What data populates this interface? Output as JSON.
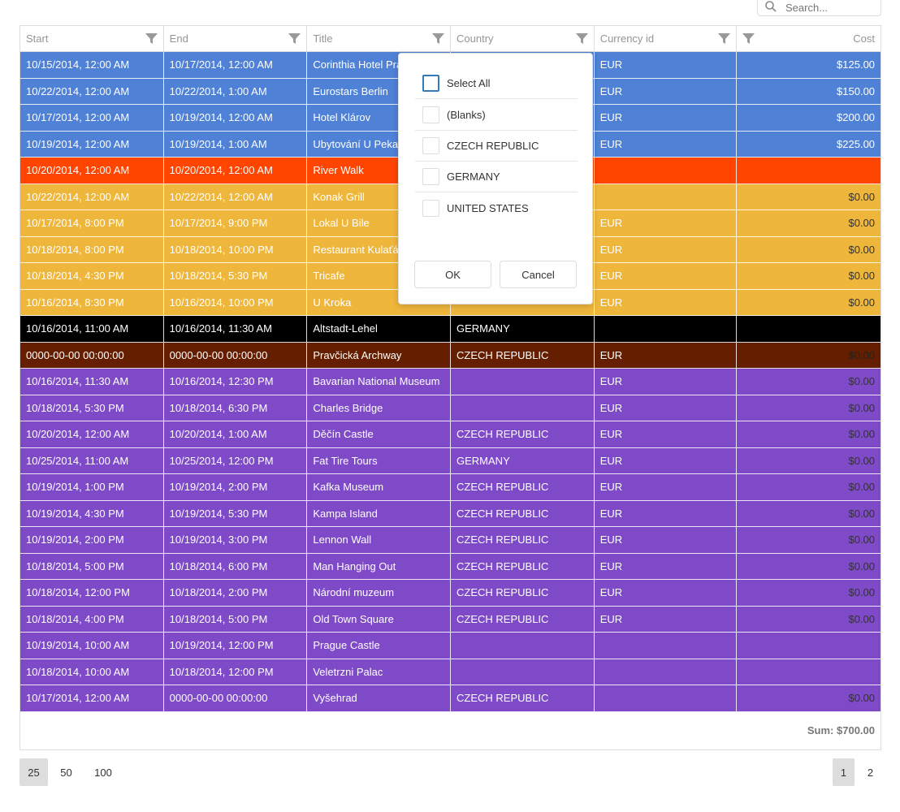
{
  "search": {
    "placeholder": "Search..."
  },
  "columns": [
    {
      "label": "Start"
    },
    {
      "label": "End"
    },
    {
      "label": "Title"
    },
    {
      "label": "Country"
    },
    {
      "label": "Currency id"
    },
    {
      "label": "Cost"
    }
  ],
  "colors": {
    "blue": "#4f81d6",
    "orange_red": "#ff4500",
    "gold": "#efb63c",
    "black": "#000000",
    "brown": "#661e00",
    "purple": "#7e4ac8"
  },
  "rows": [
    {
      "color": "#4f81d6",
      "text": "#ffffff",
      "cells": [
        "10/15/2014, 12:00 AM",
        "10/17/2014, 12:00 AM",
        "Corinthia Hotel Prague",
        "",
        "EUR",
        "$125.00"
      ]
    },
    {
      "color": "#4f81d6",
      "text": "#ffffff",
      "cells": [
        "10/22/2014, 12:00 AM",
        "10/22/2014, 1:00 AM",
        "Eurostars Berlin",
        "",
        "EUR",
        "$150.00"
      ]
    },
    {
      "color": "#4f81d6",
      "text": "#ffffff",
      "cells": [
        "10/17/2014, 12:00 AM",
        "10/19/2014, 12:00 AM",
        "Hotel Klárov",
        "",
        "EUR",
        "$200.00"
      ]
    },
    {
      "color": "#4f81d6",
      "text": "#ffffff",
      "cells": [
        "10/19/2014, 12:00 AM",
        "10/19/2014, 1:00 AM",
        "Ubytování U Pekařů",
        "",
        "EUR",
        "$225.00"
      ]
    },
    {
      "color": "#ff4500",
      "text": "#ffffff",
      "cells": [
        "10/20/2014, 12:00 AM",
        "10/20/2014, 12:00 AM",
        "River Walk",
        "",
        "",
        ""
      ]
    },
    {
      "color": "#efb63c",
      "text": "#ffffff",
      "costText": "#333333",
      "cells": [
        "10/22/2014, 12:00 AM",
        "10/22/2014, 12:00 AM",
        "Konak Grill",
        "",
        "",
        "$0.00"
      ]
    },
    {
      "color": "#efb63c",
      "text": "#ffffff",
      "costText": "#333333",
      "cells": [
        "10/17/2014, 8:00 PM",
        "10/17/2014, 9:00 PM",
        "Lokal U Bile",
        "",
        "EUR",
        "$0.00"
      ]
    },
    {
      "color": "#efb63c",
      "text": "#ffffff",
      "costText": "#333333",
      "cells": [
        "10/18/2014, 8:00 PM",
        "10/18/2014, 10:00 PM",
        "Restaurant Kulaťák",
        "",
        "EUR",
        "$0.00"
      ]
    },
    {
      "color": "#efb63c",
      "text": "#ffffff",
      "costText": "#333333",
      "cells": [
        "10/18/2014, 4:30 PM",
        "10/18/2014, 5:30 PM",
        "Tricafe",
        "",
        "EUR",
        "$0.00"
      ]
    },
    {
      "color": "#efb63c",
      "text": "#ffffff",
      "costText": "#333333",
      "cells": [
        "10/16/2014, 8:30 PM",
        "10/16/2014, 10:00 PM",
        "U Kroka",
        "",
        "EUR",
        "$0.00"
      ]
    },
    {
      "color": "#000000",
      "text": "#ffffff",
      "cells": [
        "10/16/2014, 11:00 AM",
        "10/16/2014, 11:30 AM",
        "Altstadt-Lehel",
        "GERMANY",
        "",
        ""
      ]
    },
    {
      "color": "#661e00",
      "text": "#ffffff",
      "costText": "#222222",
      "cells": [
        "0000-00-00 00:00:00",
        "0000-00-00 00:00:00",
        "Pravčická Archway",
        "CZECH REPUBLIC",
        "EUR",
        "$0.00"
      ]
    },
    {
      "color": "#7e4ac8",
      "text": "#ffffff",
      "costText": "#333333",
      "cells": [
        "10/16/2014, 11:30 AM",
        "10/16/2014, 12:30 PM",
        "Bavarian National Museum",
        "",
        "EUR",
        "$0.00"
      ]
    },
    {
      "color": "#7e4ac8",
      "text": "#ffffff",
      "costText": "#333333",
      "cells": [
        "10/18/2014, 5:30 PM",
        "10/18/2014, 6:30 PM",
        "Charles Bridge",
        "",
        "EUR",
        "$0.00"
      ]
    },
    {
      "color": "#7e4ac8",
      "text": "#ffffff",
      "costText": "#333333",
      "cells": [
        "10/20/2014, 12:00 AM",
        "10/20/2014, 1:00 AM",
        "Děčín Castle",
        "CZECH REPUBLIC",
        "EUR",
        "$0.00"
      ]
    },
    {
      "color": "#7e4ac8",
      "text": "#ffffff",
      "costText": "#333333",
      "cells": [
        "10/25/2014, 11:00 AM",
        "10/25/2014, 12:00 PM",
        "Fat Tire Tours",
        "GERMANY",
        "EUR",
        "$0.00"
      ]
    },
    {
      "color": "#7e4ac8",
      "text": "#ffffff",
      "costText": "#333333",
      "cells": [
        "10/19/2014, 1:00 PM",
        "10/19/2014, 2:00 PM",
        "Kafka Museum",
        "CZECH REPUBLIC",
        "EUR",
        "$0.00"
      ]
    },
    {
      "color": "#7e4ac8",
      "text": "#ffffff",
      "costText": "#333333",
      "cells": [
        "10/19/2014, 4:30 PM",
        "10/19/2014, 5:30 PM",
        "Kampa Island",
        "CZECH REPUBLIC",
        "EUR",
        "$0.00"
      ]
    },
    {
      "color": "#7e4ac8",
      "text": "#ffffff",
      "costText": "#333333",
      "cells": [
        "10/19/2014, 2:00 PM",
        "10/19/2014, 3:00 PM",
        "Lennon Wall",
        "CZECH REPUBLIC",
        "EUR",
        "$0.00"
      ]
    },
    {
      "color": "#7e4ac8",
      "text": "#ffffff",
      "costText": "#333333",
      "cells": [
        "10/18/2014, 5:00 PM",
        "10/18/2014, 6:00 PM",
        "Man Hanging Out",
        "CZECH REPUBLIC",
        "EUR",
        "$0.00"
      ]
    },
    {
      "color": "#7e4ac8",
      "text": "#ffffff",
      "costText": "#333333",
      "cells": [
        "10/18/2014, 12:00 PM",
        "10/18/2014, 2:00 PM",
        "Národní muzeum",
        "CZECH REPUBLIC",
        "EUR",
        "$0.00"
      ]
    },
    {
      "color": "#7e4ac8",
      "text": "#ffffff",
      "costText": "#333333",
      "cells": [
        "10/18/2014, 4:00 PM",
        "10/18/2014, 5:00 PM",
        "Old Town Square",
        "CZECH REPUBLIC",
        "EUR",
        "$0.00"
      ]
    },
    {
      "color": "#7e4ac8",
      "text": "#ffffff",
      "costText": "#333333",
      "cells": [
        "10/19/2014, 10:00 AM",
        "10/19/2014, 12:00 PM",
        "Prague Castle",
        "",
        "",
        ""
      ]
    },
    {
      "color": "#7e4ac8",
      "text": "#ffffff",
      "costText": "#333333",
      "cells": [
        "10/18/2014, 10:00 AM",
        "10/18/2014, 12:00 PM",
        "Veletrzni Palac",
        "",
        "",
        ""
      ]
    },
    {
      "color": "#7e4ac8",
      "text": "#ffffff",
      "costText": "#333333",
      "cells": [
        "10/17/2014, 12:00 AM",
        "0000-00-00 00:00:00",
        "Vyšehrad",
        "CZECH REPUBLIC",
        "",
        "$0.00"
      ]
    }
  ],
  "summary": {
    "sum_label": "Sum: $700.00"
  },
  "pager": {
    "page_sizes": [
      "25",
      "50",
      "100"
    ],
    "selected_page_size": "25",
    "pages": [
      "1",
      "2"
    ],
    "current_page": "1"
  },
  "filter_popup": {
    "options": [
      "Select All",
      "(Blanks)",
      "CZECH REPUBLIC",
      "GERMANY",
      "UNITED STATES"
    ],
    "ok_label": "OK",
    "cancel_label": "Cancel"
  }
}
